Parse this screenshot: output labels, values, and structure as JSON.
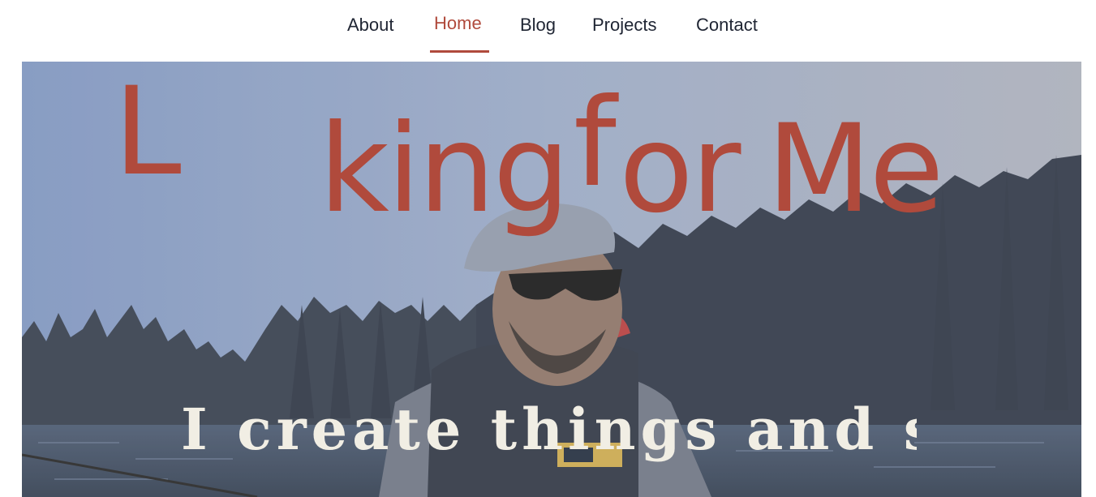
{
  "nav": {
    "items": [
      {
        "label": "About",
        "active": false
      },
      {
        "label": "Home",
        "active": true
      },
      {
        "label": "Blog",
        "active": false
      },
      {
        "label": "Projects",
        "active": false
      },
      {
        "label": "Contact",
        "active": false
      }
    ]
  },
  "hero": {
    "headline_fragments": {
      "l": "L",
      "king": "king",
      "f": "f",
      "or": "or",
      "me": "Me"
    },
    "tagline": "I create things and stu",
    "colors": {
      "accent": "#b04a3c",
      "nav_text": "#1f2533",
      "tagline": "#f1eee4"
    }
  }
}
